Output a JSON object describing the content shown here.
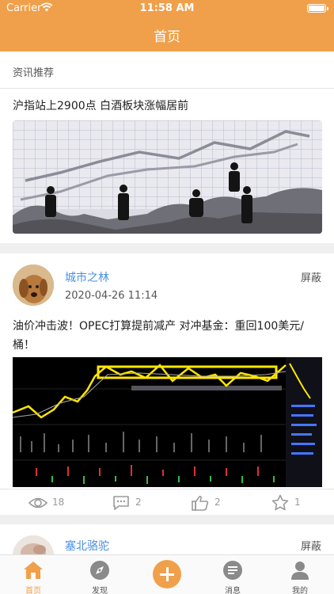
{
  "status_bar": {
    "carrier": "Carrier",
    "time": "11:58 AM"
  },
  "nav": {
    "title": "首页"
  },
  "section": {
    "label": "资讯推荐"
  },
  "news": {
    "title": "沪指站上2900点 白酒板块涨幅居前"
  },
  "post": {
    "author": "城市之林",
    "hide_label": "屏蔽",
    "time": "2020-04-26 11:14",
    "title": "油价冲击波！OPEC打算提前减产 对冲基金：重回100美元/桶！",
    "views": "18",
    "comments": "2",
    "likes": "2",
    "favorites": "1"
  },
  "next_post": {
    "author": "塞北骆驼",
    "hide_label": "屏蔽"
  },
  "tabs": [
    {
      "label": "首页",
      "icon": "home-icon",
      "active": true
    },
    {
      "label": "发现",
      "icon": "compass-icon"
    },
    {
      "label": "",
      "icon": "plus-icon"
    },
    {
      "label": "消息",
      "icon": "message-icon"
    },
    {
      "label": "我的",
      "icon": "user-icon"
    }
  ],
  "colors": {
    "accent": "#f0a04a",
    "link": "#4a90e2"
  }
}
